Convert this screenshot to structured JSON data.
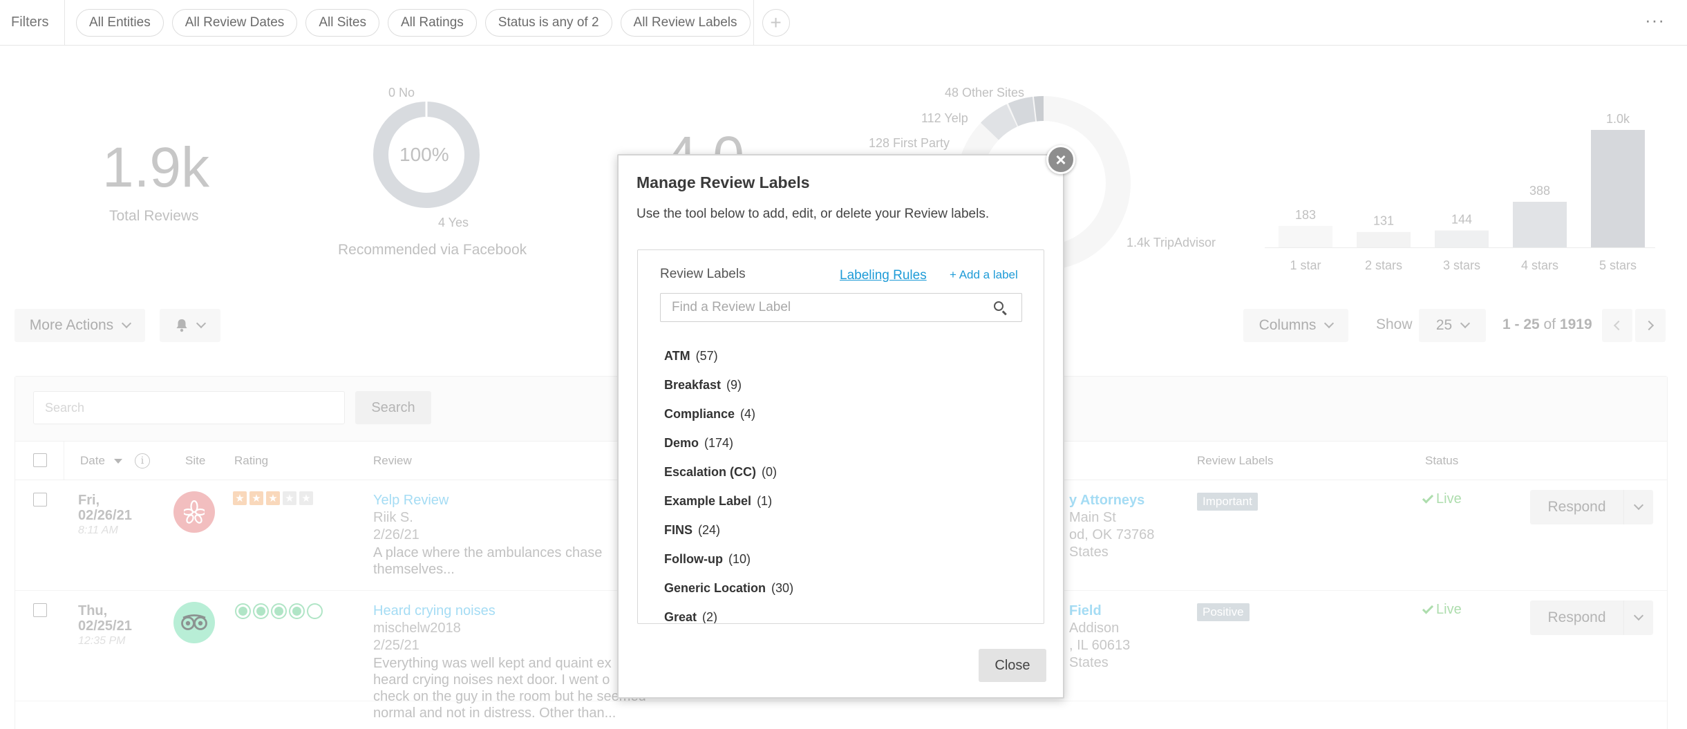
{
  "filters": {
    "label": "Filters",
    "chips": [
      "All Entities",
      "All Review Dates",
      "All Sites",
      "All Ratings",
      "Status is any of 2",
      "All Review Labels"
    ],
    "add_icon": "plus-icon",
    "more_icon": "ellipsis-icon"
  },
  "stats": {
    "total_value": "1.9k",
    "total_label": "Total Reviews",
    "recommend_pct": "100%",
    "recommend_no": "0 No",
    "recommend_yes": "4 Yes",
    "recommend_label": "Recommended via Facebook",
    "rating_partial": "4.0",
    "sites": {
      "other": "48 Other Sites",
      "yelp": "112 Yelp",
      "first_party": "128 First Party",
      "tripadvisor": "1.4k TripAdvisor"
    },
    "rating_bars": [
      {
        "label": "1 star",
        "count": "183",
        "value": 183
      },
      {
        "label": "2 stars",
        "count": "131",
        "value": 131
      },
      {
        "label": "3 stars",
        "count": "144",
        "value": 144
      },
      {
        "label": "4 stars",
        "count": "388",
        "value": 388
      },
      {
        "label": "5 stars",
        "count": "1.0k",
        "value": 1000
      }
    ]
  },
  "toolbar": {
    "more_actions": "More Actions",
    "bell_icon": "bell-icon",
    "columns": "Columns",
    "show_label": "Show",
    "page_size": "25",
    "range": "1 - 25",
    "of": "of",
    "total": "1919"
  },
  "table": {
    "search_placeholder": "Search",
    "search_button": "Search",
    "headers": {
      "date": "Date",
      "site": "Site",
      "rating": "Rating",
      "review": "Review",
      "labels": "Review Labels",
      "status": "Status"
    },
    "rows": [
      {
        "day": "Fri,",
        "date": "02/26/21",
        "time": "8:11 AM",
        "site_icon": "yelp-icon",
        "site_color": "#e8898a",
        "rating": 3,
        "title": "Yelp Review",
        "author": "Riik S.",
        "review_date": "2/26/21",
        "body": "A place where the ambulances chase themselves...",
        "location_name": "y Attorneys",
        "location_line1": "Main St",
        "location_line2": "od, OK 73768",
        "location_line3": "States",
        "label": "Important",
        "status": "Live",
        "respond": "Respond"
      },
      {
        "day": "Thu,",
        "date": "02/25/21",
        "time": "12:35 PM",
        "site_icon": "tripadvisor-icon",
        "site_color": "#7fe0b4",
        "rating": 4,
        "title": "Heard crying noises",
        "author": "mischelw2018",
        "review_date": "2/25/21",
        "body": "Everything was well kept and quaint ex heard crying noises next door. I went o check on the guy in the room but he seemed normal and not in distress. Other than...",
        "location_name": "Field",
        "location_line1": "Addison",
        "location_line2": ", IL 60613",
        "location_line3": "States",
        "label": "Positive",
        "status": "Live",
        "respond": "Respond"
      }
    ]
  },
  "modal": {
    "title": "Manage Review Labels",
    "description": "Use the tool below to add, edit, or delete your Review labels.",
    "list_header": "Review Labels",
    "rules_link": "Labeling Rules",
    "add_link": "+ Add a label",
    "search_placeholder": "Find a Review Label",
    "labels": [
      {
        "name": "ATM",
        "count": "(57)"
      },
      {
        "name": "Breakfast",
        "count": "(9)"
      },
      {
        "name": "Compliance",
        "count": "(4)"
      },
      {
        "name": "Demo",
        "count": "(174)"
      },
      {
        "name": "Escalation (CC)",
        "count": "(0)"
      },
      {
        "name": "Example Label",
        "count": "(1)"
      },
      {
        "name": "FINS",
        "count": "(24)"
      },
      {
        "name": "Follow-up",
        "count": "(10)"
      },
      {
        "name": "Generic Location",
        "count": "(30)"
      },
      {
        "name": "Great",
        "count": "(2)"
      }
    ],
    "close_button": "Close",
    "close_icon": "close-icon"
  }
}
